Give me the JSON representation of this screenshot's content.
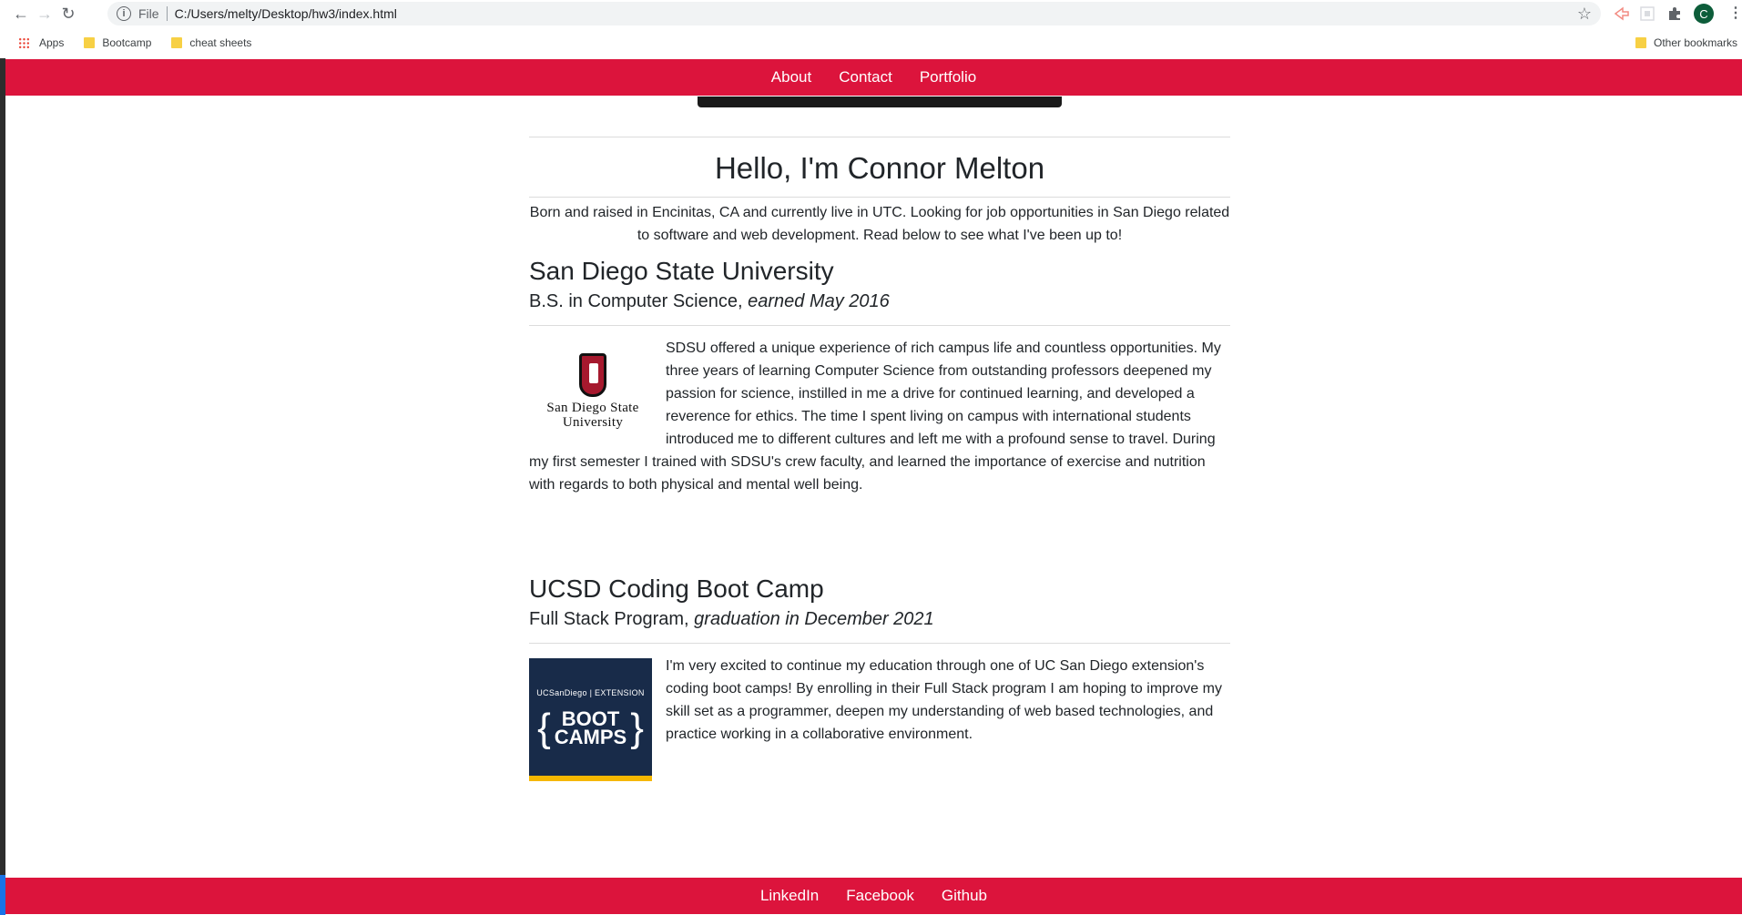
{
  "browser": {
    "file_label": "File",
    "url": "C:/Users/melty/Desktop/hw3/index.html",
    "profile_initial": "C",
    "bookmarks": [
      {
        "label": "Apps"
      },
      {
        "label": "Bootcamp"
      },
      {
        "label": "cheat sheets"
      }
    ],
    "other_bookmarks": "Other bookmarks"
  },
  "nav": {
    "items": [
      "About",
      "Contact",
      "Portfolio"
    ]
  },
  "hero": {
    "title": "Hello, I'm Connor Melton",
    "bio": "Born and raised in Encinitas, CA and currently live in UTC. Looking for job opportunities in San Diego related to software and web development. Read below to see what I've been up to!"
  },
  "sections": [
    {
      "title": "San Diego State University",
      "degree": "B.S. in Computer Science,",
      "date": "earned May 2016",
      "logo_text": [
        "San Diego State",
        "University"
      ],
      "text": "SDSU offered a unique experience of rich campus life and countless opportunities. My three years of learning Computer Science from outstanding professors deepened my passion for science, instilled in me a drive for continued learning, and developed a reverence for ethics. The time I spent living on campus with international students introduced me to different cultures and left me with a profound sense to travel. During my first semester I trained with SDSU's crew faculty, and learned the importance of exercise and nutrition with regards to both physical and mental well being."
    },
    {
      "title": "UCSD Coding Boot Camp",
      "degree": "Full Stack Program,",
      "date": "graduation in December 2021",
      "logo_top": "UCSanDiego | EXTENSION",
      "logo_main": [
        "BOOT",
        "CAMPS"
      ],
      "text": "I'm very excited to continue my education through one of UC San Diego extension's coding boot camps! By enrolling in their Full Stack program I am hoping to improve my skill set as a programmer, deepen my understanding of web based technologies, and practice working in a collaborative environment."
    }
  ],
  "footer": {
    "items": [
      "LinkedIn",
      "Facebook",
      "Github"
    ]
  },
  "colors": {
    "accent": "#dc143c",
    "ucsd_navy": "#182b49",
    "ucsd_gold": "#f5b700",
    "sdsu_red": "#a6192e"
  }
}
